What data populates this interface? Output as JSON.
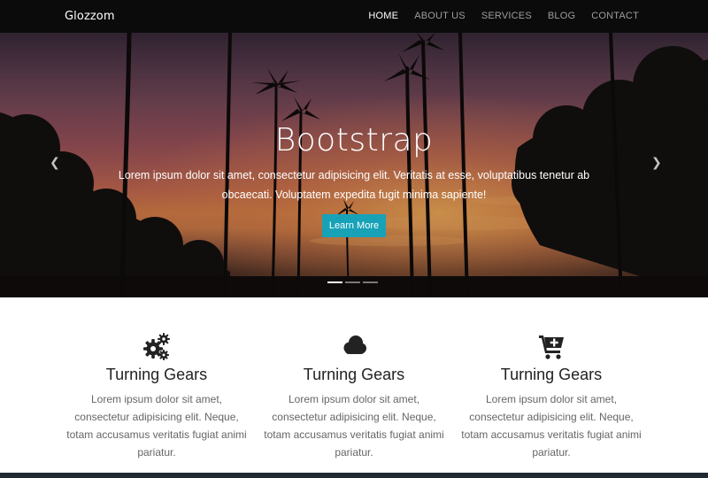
{
  "navbar": {
    "brand": "Glozzom",
    "links": [
      {
        "label": "HOME",
        "active": true
      },
      {
        "label": "ABOUT US",
        "active": false
      },
      {
        "label": "SERVICES",
        "active": false
      },
      {
        "label": "BLOG",
        "active": false
      },
      {
        "label": "CONTACT",
        "active": false
      }
    ]
  },
  "hero": {
    "title": "Bootstrap",
    "text": "Lorem ipsum dolor sit amet, consectetur adipisicing elit. Veritatis at esse, voluptatibus tenetur ab obcaecati. Voluptatem expedita fugit minima sapiente!",
    "button_label": "Learn More",
    "prev_icon": "chevron-left-icon",
    "next_icon": "chevron-right-icon",
    "slide_count": 3,
    "active_slide": 1
  },
  "features": [
    {
      "icon": "gears-icon",
      "title": "Turning Gears",
      "text": "Lorem ipsum dolor sit amet, consectetur adipisicing elit. Neque, totam accusamus veritatis fugiat animi pariatur."
    },
    {
      "icon": "cloud-icon",
      "title": "Turning Gears",
      "text": "Lorem ipsum dolor sit amet, consectetur adipisicing elit. Neque, totam accusamus veritatis fugiat animi pariatur."
    },
    {
      "icon": "cart-plus-icon",
      "title": "Turning Gears",
      "text": "Lorem ipsum dolor sit amet, consectetur adipisicing elit. Neque, totam accusamus veritatis fugiat animi pariatur."
    }
  ],
  "colors": {
    "navbar_bg": "#0b0b0b",
    "button_bg": "#17a2b8",
    "icon_color": "#222222"
  }
}
